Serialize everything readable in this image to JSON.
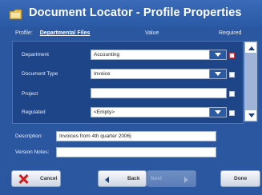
{
  "window": {
    "title": "Document Locator - Profile Properties"
  },
  "header": {
    "profile_label": "Profile:",
    "profile_name": "Departmental Files",
    "value_label": "Value",
    "required_label": "Required"
  },
  "properties": [
    {
      "label": "Department",
      "value": "Accounting",
      "type": "dropdown",
      "required": true
    },
    {
      "label": "Document Type",
      "value": "Invoice",
      "type": "dropdown",
      "required": false
    },
    {
      "label": "Project",
      "value": "",
      "type": "text",
      "required": false
    },
    {
      "label": "Regulated",
      "value": "<Empty>",
      "type": "dropdown",
      "required": false
    }
  ],
  "description": {
    "label": "Description:",
    "value": "Invoices from 4th quarter 2006|"
  },
  "version_notes": {
    "label": "Version Notes:",
    "value": ""
  },
  "buttons": {
    "cancel": "Cancel",
    "back": "Back",
    "next": "Next",
    "done": "Done"
  },
  "colors": {
    "window_bg": "#2b57a0",
    "panel_bg": "#1f4589",
    "required_box": "#d23a3a",
    "cancel_icon": "#d41a1a"
  },
  "icons": {
    "app": "document-locator-folder-icon",
    "cancel": "close-icon"
  }
}
